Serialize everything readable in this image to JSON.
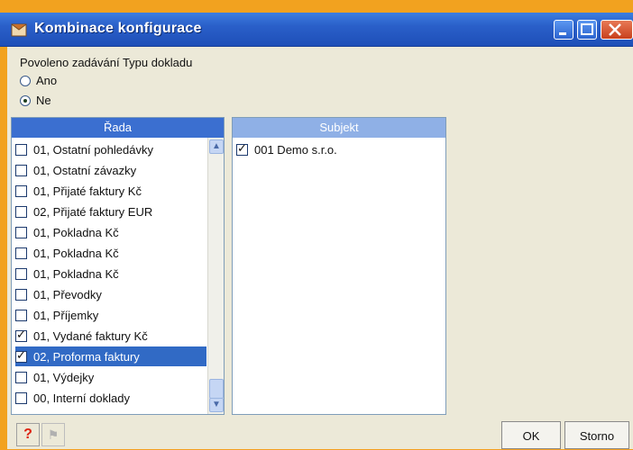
{
  "window": {
    "title": "Kombinace konfigurace"
  },
  "options": {
    "prompt": "Povoleno zadávání Typu dokladu",
    "radio_yes": "Ano",
    "radio_no": "Ne",
    "selected": "Ne"
  },
  "rada": {
    "header": "Řada",
    "items": [
      {
        "label": "01, Ostatní pohledávky",
        "checked": false
      },
      {
        "label": "01, Ostatní závazky",
        "checked": false
      },
      {
        "label": "01, Přijaté faktury Kč",
        "checked": false
      },
      {
        "label": "02, Přijaté faktury EUR",
        "checked": false
      },
      {
        "label": "01, Pokladna Kč",
        "checked": false
      },
      {
        "label": "01, Pokladna Kč",
        "checked": false
      },
      {
        "label": "01, Pokladna Kč",
        "checked": false
      },
      {
        "label": "01, Převodky",
        "checked": false
      },
      {
        "label": "01, Příjemky",
        "checked": false
      },
      {
        "label": "01, Vydané faktury Kč",
        "checked": true
      },
      {
        "label": "02, Proforma faktury",
        "checked": true,
        "selected": true
      },
      {
        "label": "01, Výdejky",
        "checked": false
      },
      {
        "label": "00, Interní doklady",
        "checked": false
      }
    ]
  },
  "subjekt": {
    "header": "Subjekt",
    "items": [
      {
        "label": "001 Demo s.r.o.",
        "checked": true
      }
    ]
  },
  "footer": {
    "ok": "OK",
    "cancel": "Storno",
    "help": "?"
  },
  "colors": {
    "title_bar": "#2a5fc9",
    "selection": "#316ac5",
    "header_active": "#3b6fd0",
    "header_inactive": "#8fb0e6"
  }
}
